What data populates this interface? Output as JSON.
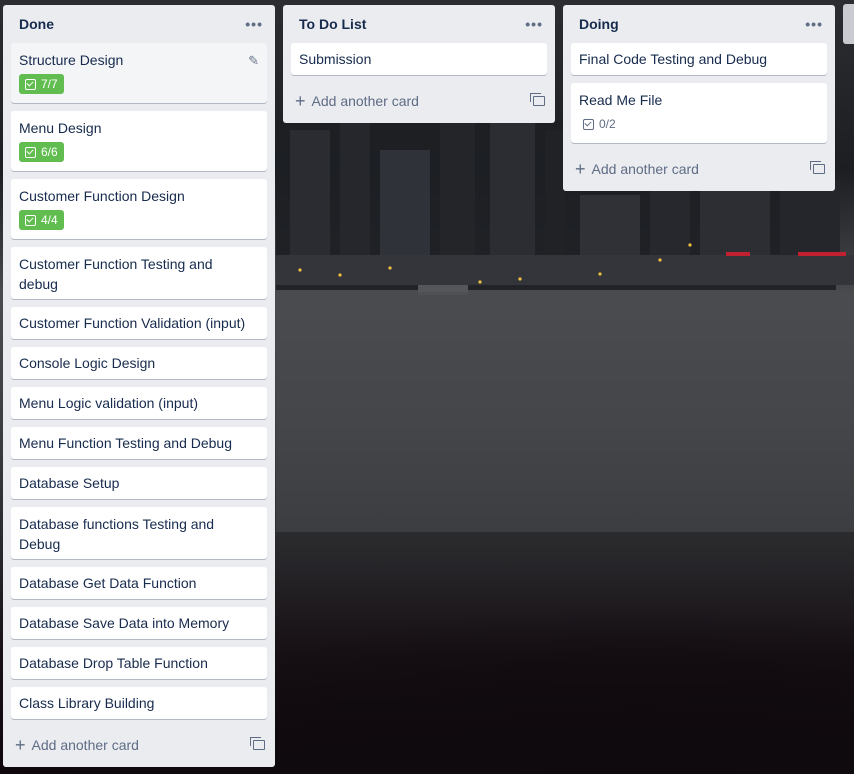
{
  "lists": [
    {
      "title": "Done",
      "menu": "•••",
      "cards": [
        {
          "title": "Structure Design",
          "badge": "7/7"
        },
        {
          "title": "Menu Design",
          "badge": "6/6"
        },
        {
          "title": "Customer Function Design",
          "badge": "4/4"
        },
        {
          "title": "Customer Function Testing and debug"
        },
        {
          "title": "Customer Function Validation (input)"
        },
        {
          "title": "Console Logic Design"
        },
        {
          "title": "Menu Logic validation (input)"
        },
        {
          "title": "Menu Function Testing and Debug"
        },
        {
          "title": "Database Setup"
        },
        {
          "title": "Database functions Testing and Debug"
        },
        {
          "title": "Database Get Data Function"
        },
        {
          "title": "Database Save Data into Memory"
        },
        {
          "title": "Database Drop Table Function"
        },
        {
          "title": "Class Library Building"
        }
      ],
      "add_label": "Add another card"
    },
    {
      "title": "To Do List",
      "menu": "•••",
      "cards": [
        {
          "title": "Submission"
        }
      ],
      "add_label": "Add another card"
    },
    {
      "title": "Doing",
      "menu": "•••",
      "cards": [
        {
          "title": "Final Code Testing and Debug"
        },
        {
          "title": "Read Me File",
          "badge": "0/2"
        }
      ],
      "add_label": "Add another card"
    }
  ],
  "colors": {
    "list_bg": "#ebecf0",
    "card_bg": "#ffffff",
    "badge_complete": "#61bd4f",
    "text": "#172b4d"
  }
}
